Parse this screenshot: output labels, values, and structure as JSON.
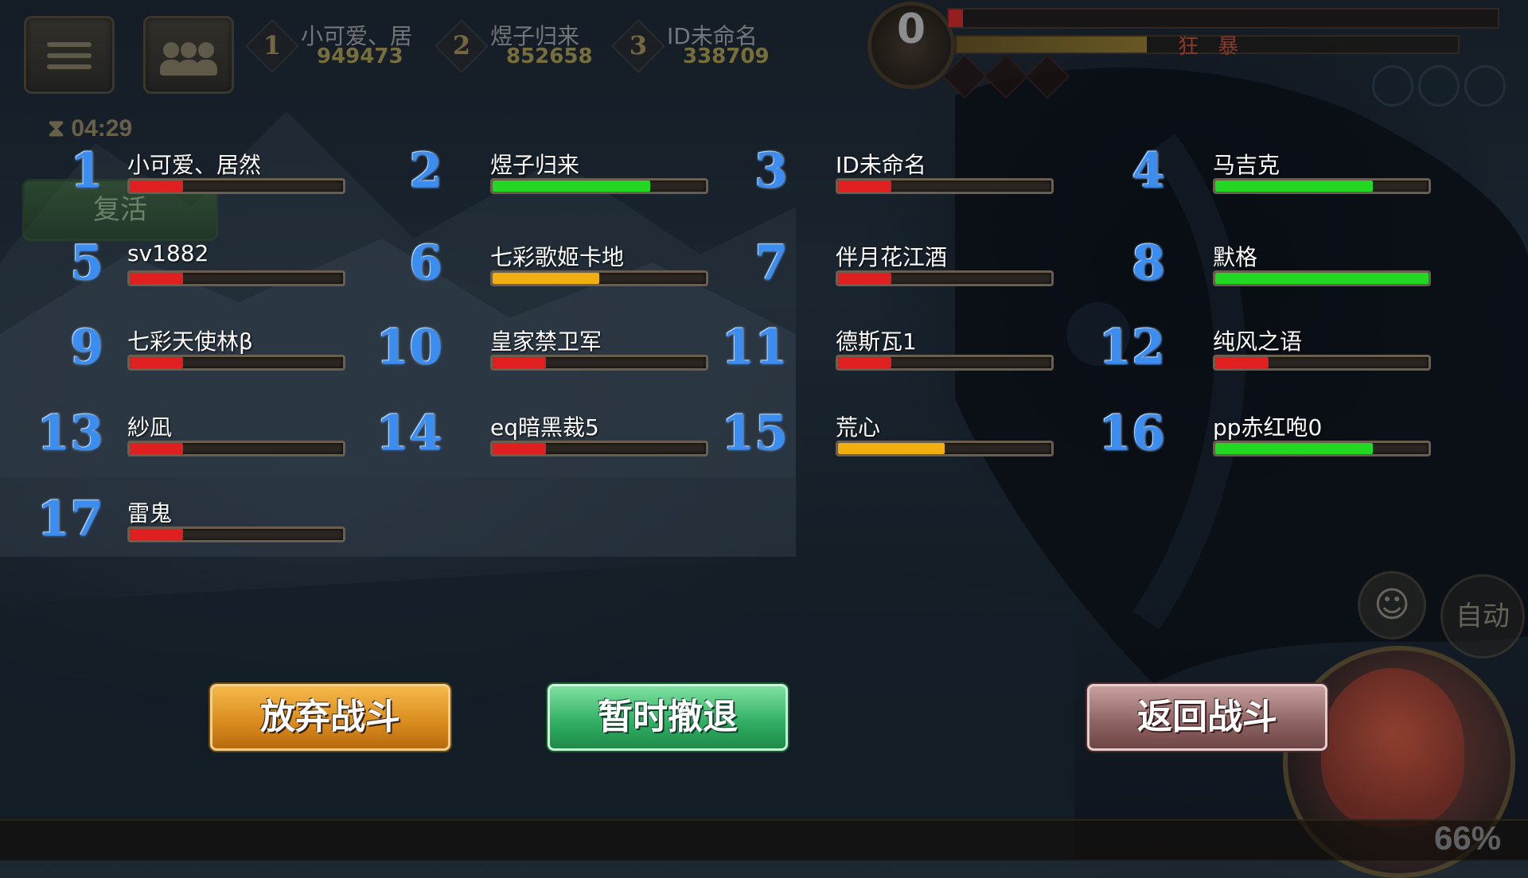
{
  "hud": {
    "ranking": [
      {
        "rank": "1",
        "name": "小可爱、居",
        "score": "949473"
      },
      {
        "rank": "2",
        "name": "煜子归来",
        "score": "852658"
      },
      {
        "rank": "3",
        "name": "ID未命名",
        "score": "338709"
      }
    ],
    "timer": "04:29",
    "revive_label": "复活",
    "boss_counter": "0",
    "rage_label": "狂 暴"
  },
  "players": [
    {
      "num": "1",
      "name": "小可爱、居然",
      "hp": 0.25,
      "color": "#e02020"
    },
    {
      "num": "2",
      "name": "煜子归来",
      "hp": 0.74,
      "color": "#22d822"
    },
    {
      "num": "3",
      "name": "ID未命名",
      "hp": 0.25,
      "color": "#e02020"
    },
    {
      "num": "4",
      "name": "马吉克",
      "hp": 0.74,
      "color": "#22d822"
    },
    {
      "num": "5",
      "name": "sv1882",
      "hp": 0.25,
      "color": "#e02020"
    },
    {
      "num": "6",
      "name": "七彩歌姬卡地",
      "hp": 0.5,
      "color": "#f2b010"
    },
    {
      "num": "7",
      "name": "伴月花江酒",
      "hp": 0.25,
      "color": "#e02020"
    },
    {
      "num": "8",
      "name": "默格",
      "hp": 1.0,
      "color": "#22d822"
    },
    {
      "num": "9",
      "name": "七彩天使林β",
      "hp": 0.25,
      "color": "#e02020"
    },
    {
      "num": "10",
      "name": "皇家禁卫军",
      "hp": 0.25,
      "color": "#e02020"
    },
    {
      "num": "11",
      "name": "德斯瓦1",
      "hp": 0.25,
      "color": "#e02020"
    },
    {
      "num": "12",
      "name": "纯风之语",
      "hp": 0.25,
      "color": "#e02020"
    },
    {
      "num": "13",
      "name": "紗凪",
      "hp": 0.25,
      "color": "#e02020"
    },
    {
      "num": "14",
      "name": "eq暗黑裁5",
      "hp": 0.25,
      "color": "#e02020"
    },
    {
      "num": "15",
      "name": "荒心",
      "hp": 0.5,
      "color": "#f2b010"
    },
    {
      "num": "16",
      "name": "pp赤红咆0",
      "hp": 0.74,
      "color": "#22d822"
    },
    {
      "num": "17",
      "name": "雷鬼",
      "hp": 0.25,
      "color": "#e02020"
    }
  ],
  "buttons": {
    "abandon": "放弃战斗",
    "retreat": "暂时撤退",
    "return": "返回战斗"
  },
  "side": {
    "auto_label": "自动",
    "emoji_icon": "☺",
    "percent": "66%"
  },
  "colors": {
    "hp_low": "#e02020",
    "hp_mid": "#f2b010",
    "hp_high": "#22d822",
    "player_number": "#3b8df0"
  }
}
